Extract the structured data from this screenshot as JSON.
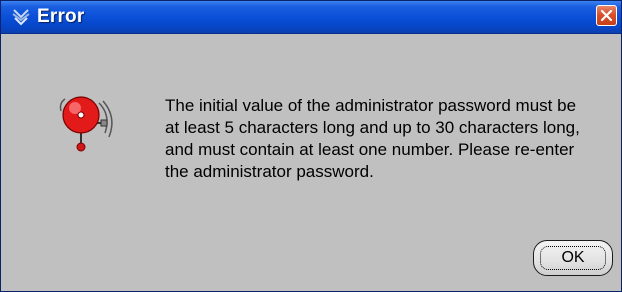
{
  "window": {
    "title": "Error",
    "title_icon": "java-cup-icon",
    "close_icon": "close-icon"
  },
  "dialog": {
    "icon": "alarm-bell-icon",
    "message": "The initial value of the administrator password must be\nat least 5 characters long and up to 30 characters long,\nand must contain at least one number. Please re-enter\nthe administrator password.",
    "ok_label": "OK"
  },
  "colors": {
    "titlebar": "#0a50d8",
    "body": "#c0c0c0",
    "close_button": "#d9512a",
    "bell": "#e02020"
  }
}
